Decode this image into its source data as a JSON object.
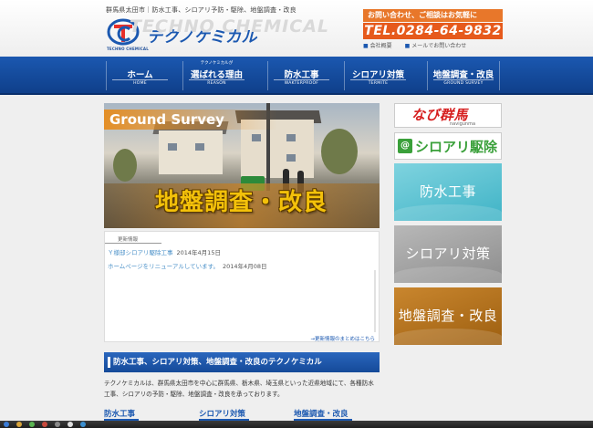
{
  "header": {
    "tagline": "群馬県太田市｜防水工事、シロアリ予防・駆除、地盤調査・改良",
    "logo_text": "テクノケミカル",
    "logo_sub": "TECHNO CHEMICAL",
    "logo_ghost": "TECHNO CHEMICAL",
    "contact_line": "お問い合わせ、ご相談はお気軽に",
    "phone": "TEL.0284-64-9832",
    "links": [
      "会社概要",
      "メールでお問い合わせ"
    ]
  },
  "nav": [
    {
      "pre": "",
      "main": "ホーム",
      "sub": "HOME"
    },
    {
      "pre": "テクノケミカルが",
      "main": "選ばれる理由",
      "sub": "REASON"
    },
    {
      "pre": "",
      "main": "防水工事",
      "sub": "WAKTERPROOF"
    },
    {
      "pre": "",
      "main": "シロアリ対策",
      "sub": "TERMITE"
    },
    {
      "pre": "",
      "main": "地盤調査・改良",
      "sub": "GROUND SURVEY"
    }
  ],
  "hero": {
    "label_en": "Ground Survey",
    "label_jp": "地盤調査・改良"
  },
  "news": {
    "heading": "更新情報",
    "items": [
      {
        "title": "Ｙ様邸シロアリ駆除工事",
        "date": "2014年4月15日"
      },
      {
        "title": "ホームページをリニューアルしています。",
        "date": "2014年4月08日"
      }
    ],
    "more": "→更新情報のまとめはこちら"
  },
  "main": {
    "heading": "防水工事、シロアリ対策、地盤調査・改良のテクノケミカル",
    "intro": "テクノケミカルは、群馬県太田市を中心に群馬県、栃木県、埼玉県といった近県地域にて、各種防水工事、シロアリの予防・駆除、地盤調査・改良を承っております。",
    "bottom_tabs": [
      "防水工事",
      "シロアリ対策",
      "地盤調査・改良"
    ]
  },
  "sidebar": {
    "navi_logo": "なび群馬",
    "navi_sub": "navigunma",
    "shiroari_badge": "@",
    "shiroari_text": "シロアリ駆除",
    "banners": [
      "防水工事",
      "シロアリ対策",
      "地盤調査・改良"
    ]
  },
  "colors": {
    "brand_blue": "#1b58b0",
    "orange": "#e65a1c",
    "water": "#3fb3c6",
    "termite": "#8d8d8d",
    "ground": "#9d5f10"
  }
}
